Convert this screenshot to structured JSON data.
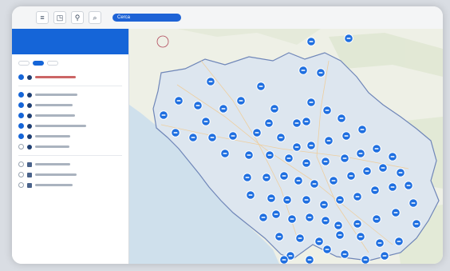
{
  "topbar": {
    "tools": [
      {
        "icon": "grid-icon",
        "glyph": "≡"
      },
      {
        "icon": "layers-icon",
        "glyph": "◳"
      },
      {
        "icon": "filter-icon",
        "glyph": "⚲"
      },
      {
        "icon": "search-icon",
        "glyph": "⌕"
      }
    ],
    "search_chip": "Cerca"
  },
  "sidebar": {
    "header_line1": "",
    "header_line2": "",
    "tabs": [
      {
        "label": "",
        "active": false
      },
      {
        "label": "",
        "active": true
      },
      {
        "label": "",
        "active": false
      }
    ],
    "layers": [],
    "layers2": []
  },
  "map": {
    "accent": "#1565d8",
    "sea_color": "#cfe0ec",
    "land_color": "#eef0e6",
    "region_fill": "#dde6ef",
    "boundary_color": "#6f86b8",
    "marker_color": "#1f6fe0"
  }
}
